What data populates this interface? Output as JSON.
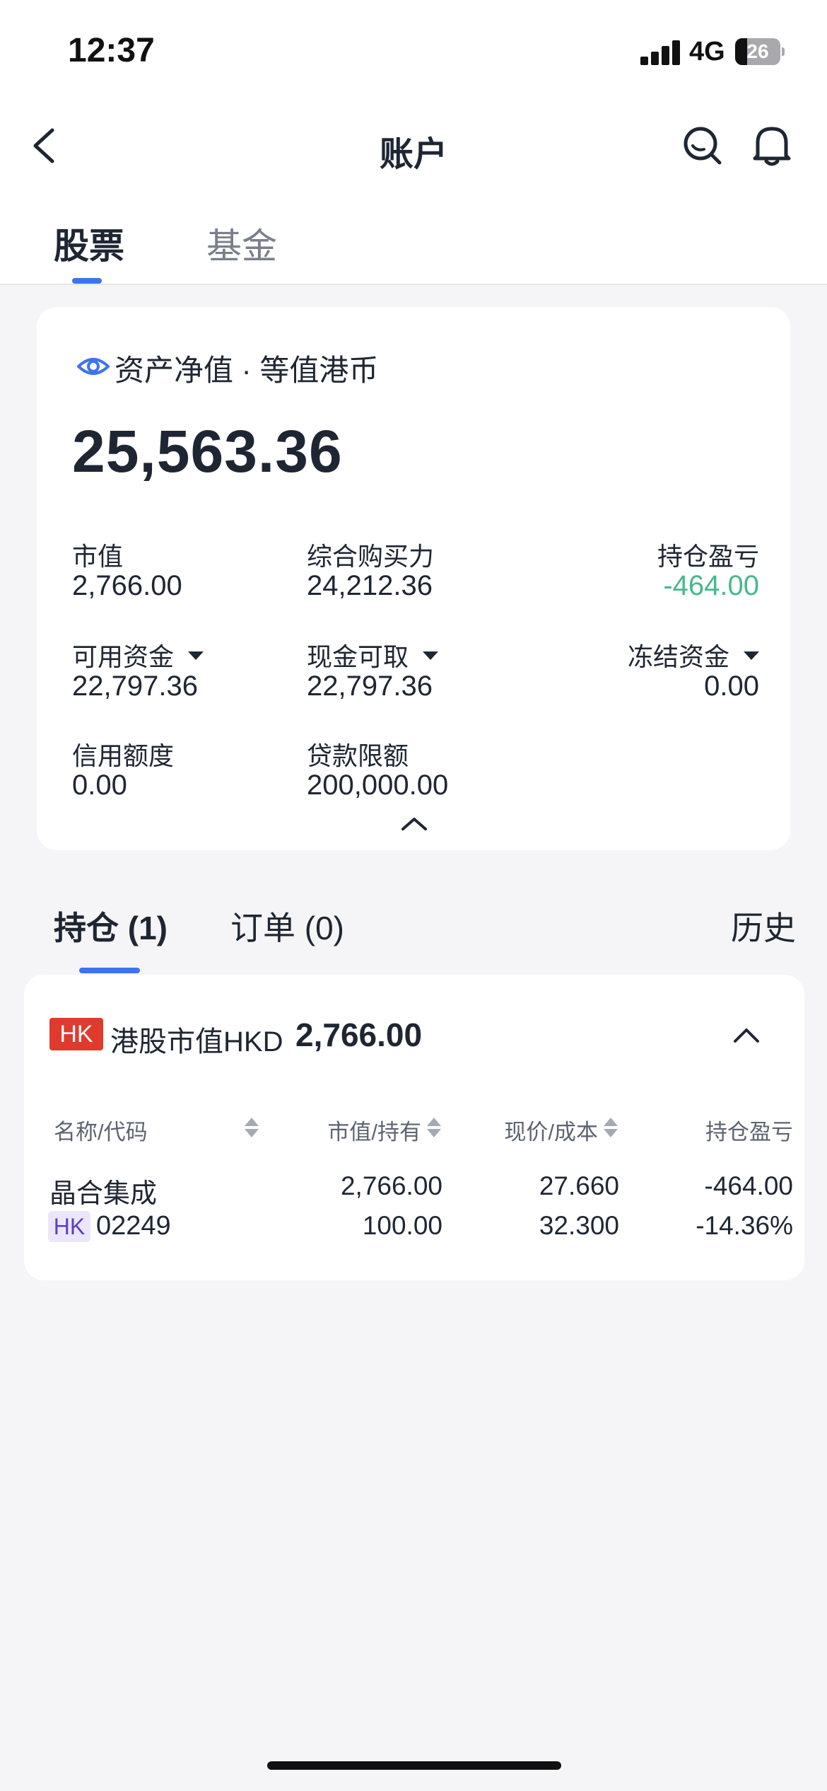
{
  "status_bar": {
    "time": "12:37",
    "network": "4G",
    "battery": "26"
  },
  "nav": {
    "title": "账户"
  },
  "main_tabs": [
    {
      "label": "股票"
    },
    {
      "label": "基金"
    }
  ],
  "summary": {
    "net_asset_label": "资产净值 · 等值港币",
    "net_asset_value": "25,563.36",
    "metrics": {
      "market_value": {
        "label": "市值",
        "value": "2,766.00"
      },
      "buying_power": {
        "label": "综合购买力",
        "value": "24,212.36"
      },
      "position_pnl": {
        "label": "持仓盈亏",
        "value": "-464.00"
      },
      "available_cash": {
        "label": "可用资金",
        "value": "22,797.36"
      },
      "withdrawable_cash": {
        "label": "现金可取",
        "value": "22,797.36"
      },
      "frozen_cash": {
        "label": "冻结资金",
        "value": "0.00"
      },
      "credit_limit": {
        "label": "信用额度",
        "value": "0.00"
      },
      "loan_limit": {
        "label": "贷款限额",
        "value": "200,000.00"
      }
    }
  },
  "holdings_tabs": {
    "positions": "持仓 (1)",
    "orders": "订单 (0)",
    "history": "历史"
  },
  "holdings": {
    "market_badge": "HK",
    "market_value_label": "港股市值HKD",
    "market_value": "2,766.00",
    "columns": [
      "名称/代码",
      "市值/持有",
      "现价/成本",
      "持仓盈亏"
    ],
    "rows": [
      {
        "name": "晶合集成",
        "market_tag": "HK",
        "code": "02249",
        "market_value": "2,766.00",
        "quantity": "100.00",
        "price": "27.660",
        "cost": "32.300",
        "pnl": "-464.00",
        "pnl_pct": "-14.36%"
      }
    ]
  },
  "colors": {
    "accent": "#3d73f0",
    "gain_loss": "#47b98a",
    "hk_badge": "#e03a2c"
  }
}
